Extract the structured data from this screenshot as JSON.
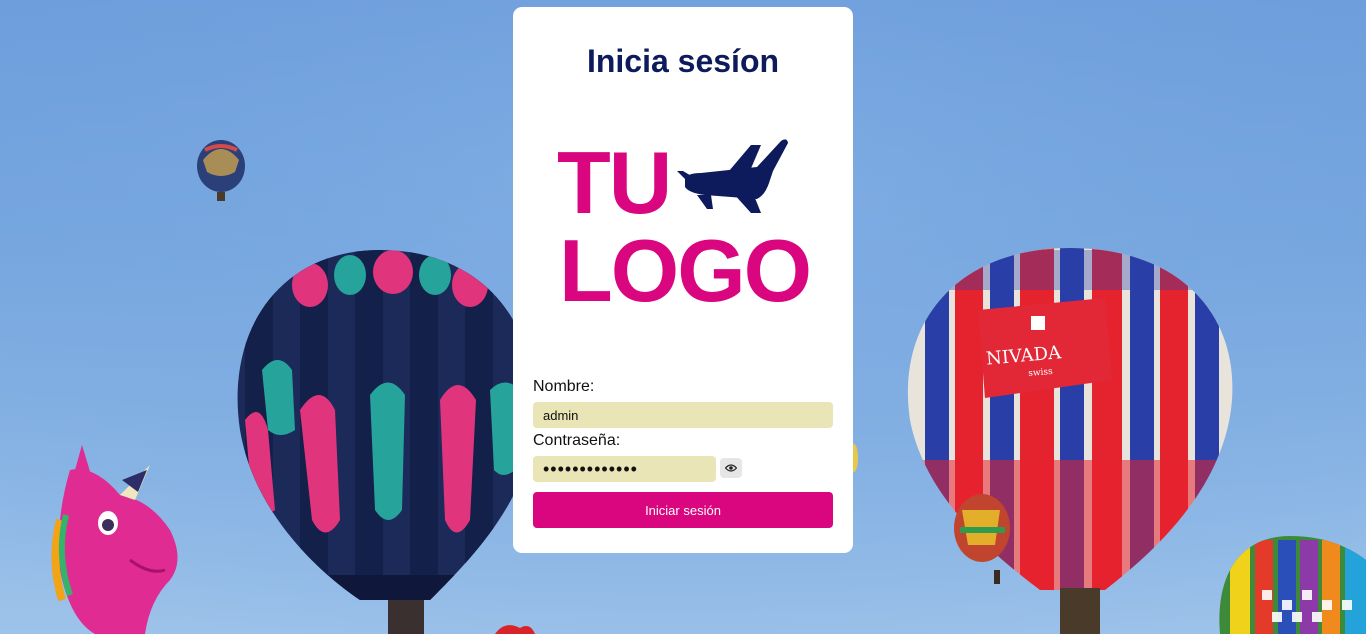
{
  "login": {
    "title": "Inicia sesíon",
    "logo": {
      "line1": "TU",
      "line2": "LOGO",
      "icon": "airplane-icon"
    },
    "name_label": "Nombre:",
    "name_value": "admin",
    "password_label": "Contraseña:",
    "password_value": "•••••••••••••",
    "toggle_icon": "eye-icon",
    "submit_label": "Iniciar sesión"
  },
  "background": {
    "balloon_banner_text": "NIVADA",
    "balloon_banner_subtext": "swiss"
  },
  "colors": {
    "accent": "#d9067f",
    "title": "#0d1a5c",
    "input_bg": "#e9e5b6",
    "card": "#ffffff"
  }
}
